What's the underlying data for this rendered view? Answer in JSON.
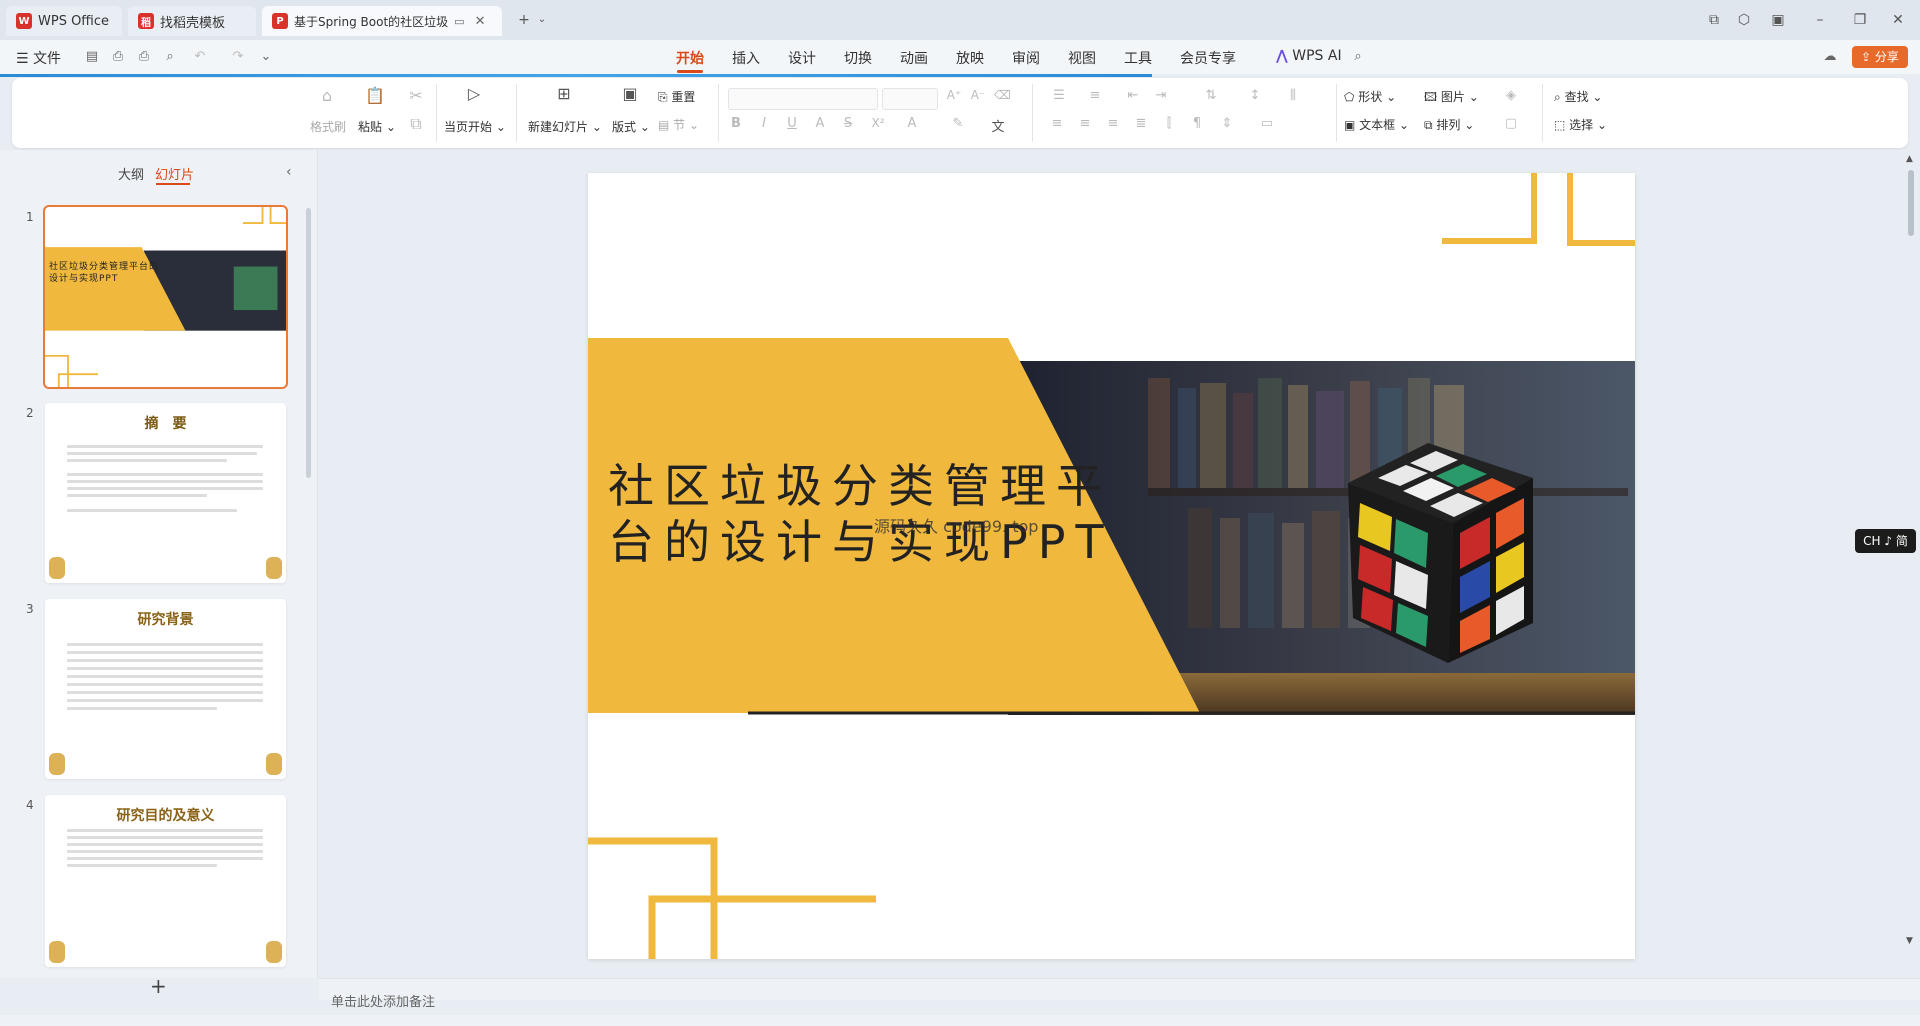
{
  "tabs": [
    {
      "label": "WPS Office",
      "icon": "wps-logo-icon",
      "color": "#d8322a"
    },
    {
      "label": "找稻壳模板",
      "icon": "docer-icon",
      "color": "#d8322a"
    },
    {
      "label": "基于Spring Boot的社区垃圾",
      "icon": "ppt-file-icon",
      "color": "#d8322a"
    }
  ],
  "menu": {
    "file": "文件",
    "items": [
      "开始",
      "插入",
      "设计",
      "切换",
      "动画",
      "放映",
      "审阅",
      "视图",
      "工具",
      "会员专享"
    ],
    "active": "开始",
    "wps_ai": "WPS AI",
    "share": "分享"
  },
  "ribbon": {
    "format_brush": "格式刷",
    "paste": "粘贴",
    "from_current": "当页开始",
    "new_slide": "新建幻灯片",
    "layout": "版式",
    "reset": "重置",
    "section": "节",
    "shape": "形状",
    "image": "图片",
    "find": "查找",
    "textbox": "文本框",
    "arrange": "排列",
    "select": "选择"
  },
  "panel": {
    "tab_outline": "大纲",
    "tab_slides": "幻灯片",
    "add": "+"
  },
  "slides": [
    {
      "num": "1",
      "title": "社区垃圾分类管理平台的设计与实现PPT"
    },
    {
      "num": "2",
      "title": "摘　要"
    },
    {
      "num": "3",
      "title": "研究背景"
    },
    {
      "num": "4",
      "title": "研究目的及意义"
    }
  ],
  "slide": {
    "title_line1": "社区垃圾分类管理平",
    "title_line2": "台的设计与实现PPT",
    "watermark": "源码久久 code99. top"
  },
  "notes_placeholder": "单击此处添加备注",
  "ime": "CH ♪ 简",
  "colors": {
    "accent": "#f0b93e",
    "brand": "#d9491a"
  }
}
